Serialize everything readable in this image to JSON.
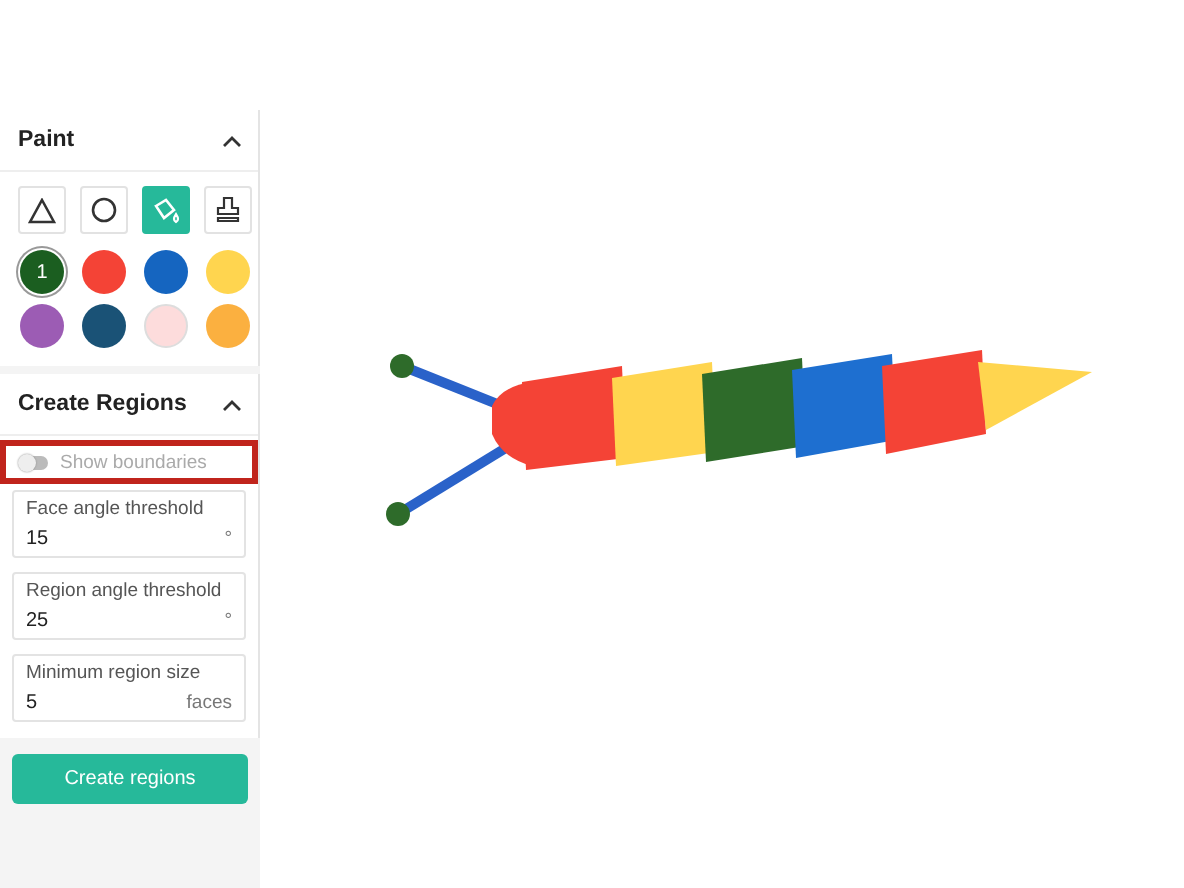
{
  "paint": {
    "title": "Paint",
    "expanded": true,
    "tools": [
      {
        "kind": "triangle",
        "selected": false
      },
      {
        "kind": "circle",
        "selected": false
      },
      {
        "kind": "fill",
        "selected": true
      },
      {
        "kind": "stamp",
        "selected": false
      }
    ],
    "swatches": [
      {
        "color": "#1b5e20",
        "selected": true,
        "label": "1"
      },
      {
        "color": "#f44336",
        "selected": false
      },
      {
        "color": "#1565c0",
        "selected": false
      },
      {
        "color": "#ffd54f",
        "selected": false
      },
      {
        "color": "#9c5cb4",
        "selected": false
      },
      {
        "color": "#1a5276",
        "selected": false
      },
      {
        "color": "#fddcdc",
        "selected": false
      },
      {
        "color": "#fbb040",
        "selected": false
      }
    ]
  },
  "create_regions": {
    "title": "Create Regions",
    "expanded": true,
    "show_boundaries": {
      "label": "Show boundaries",
      "on": false,
      "disabled": true,
      "highlighted": true
    },
    "fields": [
      {
        "label": "Face angle threshold",
        "value": "15",
        "unit": "°"
      },
      {
        "label": "Region angle threshold",
        "value": "25",
        "unit": "°"
      },
      {
        "label": "Minimum region size",
        "value": "5",
        "unit": "faces"
      }
    ],
    "button": "Create regions"
  },
  "viewport": {
    "kind": "model"
  }
}
